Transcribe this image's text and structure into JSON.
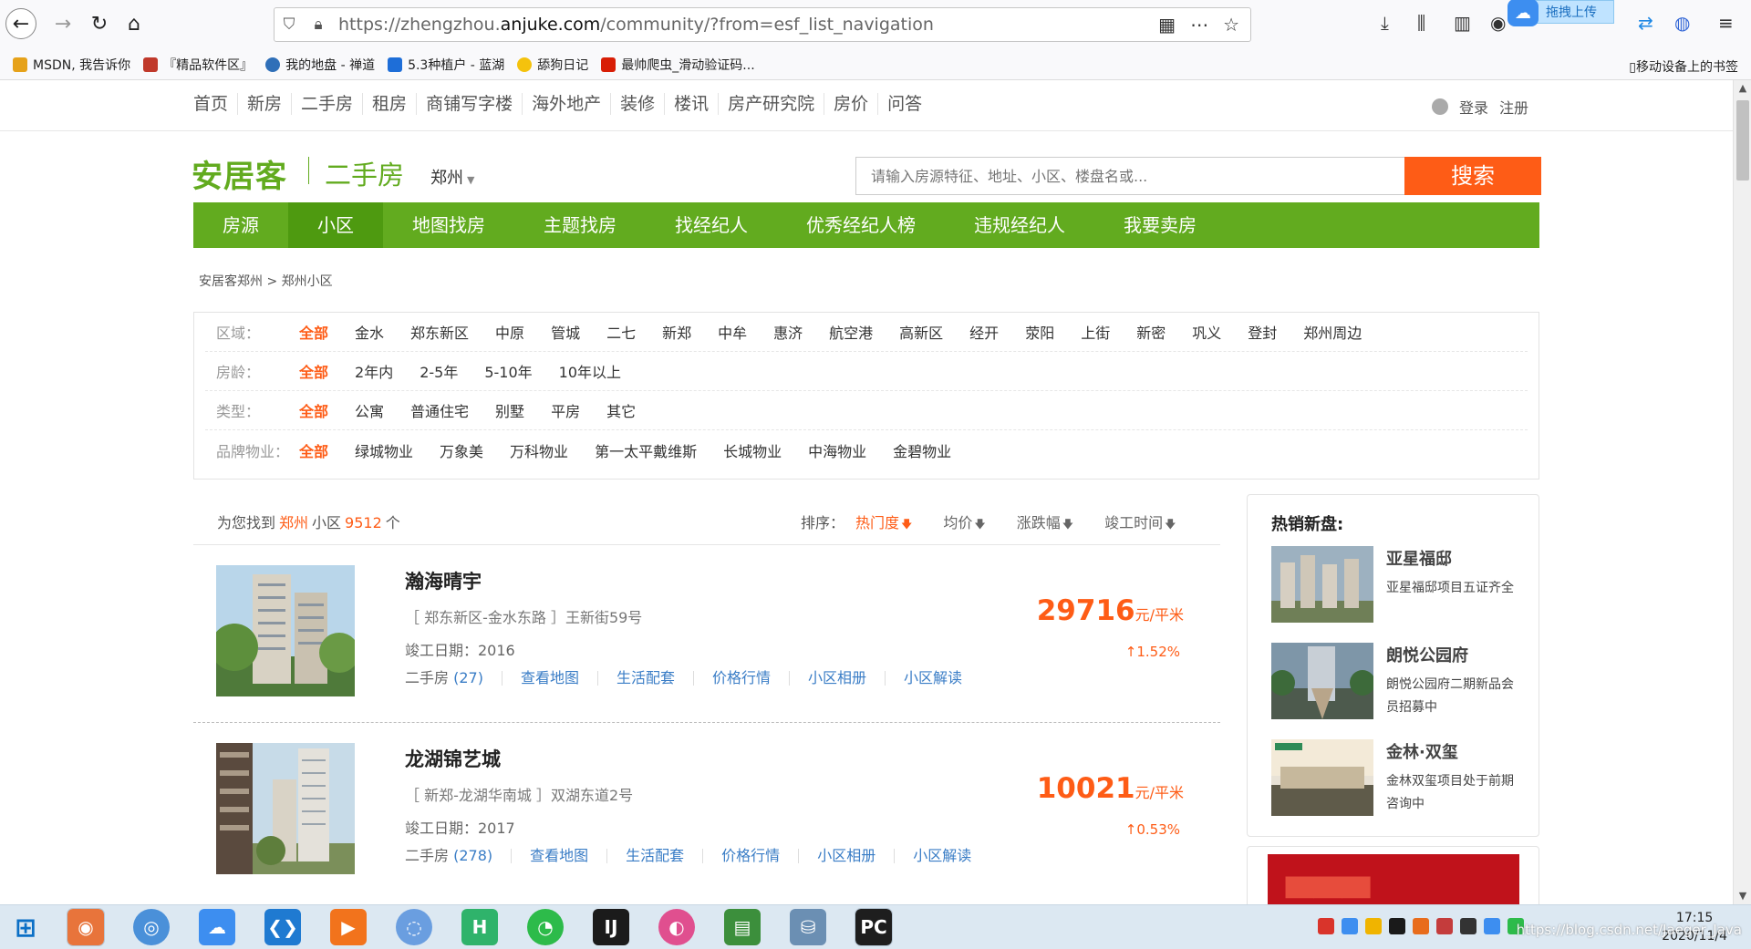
{
  "browser": {
    "url_prefix": "https://zhengzhou.",
    "url_domain": "anjuke.com",
    "url_suffix": "/community/?from=esf_list_navigation",
    "upload_label": "拖拽上传"
  },
  "bookmarks": [
    {
      "label": "MSDN, 我告诉你",
      "color": "#e6a21a"
    },
    {
      "label": "『精品软件区』",
      "color": "#c0392b"
    },
    {
      "label": "我的地盘 - 禅道",
      "color": "#2f6fb8"
    },
    {
      "label": "5.3种植户 - 蓝湖",
      "color": "#1e6ed8"
    },
    {
      "label": "舔狗日记",
      "color": "#f4c20d"
    },
    {
      "label": "最帅爬虫_滑动验证码...",
      "color": "#d81e06"
    }
  ],
  "bookmarks_mobile": "移动设备上的书签",
  "topnav": {
    "links": [
      "首页",
      "新房",
      "二手房",
      "租房",
      "商铺写字楼",
      "海外地产",
      "装修",
      "楼讯",
      "房产研究院",
      "房价",
      "问答"
    ],
    "login": "登录",
    "register": "注册"
  },
  "header": {
    "logo": "安居客",
    "sub": "二手房",
    "city": "郑州",
    "search_placeholder": "请输入房源特征、地址、小区、楼盘名或...",
    "search_button": "搜索"
  },
  "greennav": [
    "房源",
    "小区",
    "地图找房",
    "主题找房",
    "找经纪人",
    "优秀经纪人榜",
    "违规经纪人",
    "我要卖房"
  ],
  "greennav_active": 1,
  "breadcrumb": "安居客郑州 > 郑州小区",
  "filters": [
    {
      "label": "区域：",
      "options": [
        "全部",
        "金水",
        "郑东新区",
        "中原",
        "管城",
        "二七",
        "新郑",
        "中牟",
        "惠济",
        "航空港",
        "高新区",
        "经开",
        "荥阳",
        "上街",
        "新密",
        "巩义",
        "登封",
        "郑州周边"
      ]
    },
    {
      "label": "房龄：",
      "options": [
        "全部",
        "2年内",
        "2-5年",
        "5-10年",
        "10年以上"
      ]
    },
    {
      "label": "类型：",
      "options": [
        "全部",
        "公寓",
        "普通住宅",
        "别墅",
        "平房",
        "其它"
      ]
    },
    {
      "label": "品牌物业：",
      "options": [
        "全部",
        "绿城物业",
        "万象美",
        "万科物业",
        "第一太平戴维斯",
        "长城物业",
        "中海物业",
        "金碧物业"
      ]
    }
  ],
  "results": {
    "prefix": "为您找到",
    "city": "郑州",
    "middle": "小区",
    "count": "9512",
    "suffix": "个",
    "sort_label": "排序：",
    "sort_options": [
      "热门度",
      "均价",
      "涨跌幅",
      "竣工时间"
    ]
  },
  "communities": [
    {
      "name": "瀚海晴宇",
      "address": "［ 郑东新区-金水东路 ］王新街59号",
      "completed": "竣工日期：2016",
      "esf_label": "二手房",
      "esf_count": "(27)",
      "links": [
        "查看地图",
        "生活配套",
        "价格行情",
        "小区相册",
        "小区解读"
      ],
      "price": "29716",
      "unit": "元/平米",
      "change": "↑1.52%"
    },
    {
      "name": "龙湖锦艺城",
      "address": "［ 新郑-龙湖华南城 ］双湖东道2号",
      "completed": "竣工日期：2017",
      "esf_label": "二手房",
      "esf_count": "(278)",
      "links": [
        "查看地图",
        "生活配套",
        "价格行情",
        "小区相册",
        "小区解读"
      ],
      "price": "10021",
      "unit": "元/平米",
      "change": "↑0.53%"
    }
  ],
  "sidebar": {
    "title": "热销新盘:",
    "items": [
      {
        "name": "亚星福邸",
        "desc": "亚星福邸项目五证齐全"
      },
      {
        "name": "朗悦公园府",
        "desc": "朗悦公园府二期新品会员招募中"
      },
      {
        "name": "金林·双玺",
        "desc": "金林双玺项目处于前期咨询中"
      }
    ]
  },
  "taskbar": {
    "time": "17:15",
    "date": "2020/11/4",
    "watermark": "https://blog.csdn.net/Jaeger_Java"
  }
}
